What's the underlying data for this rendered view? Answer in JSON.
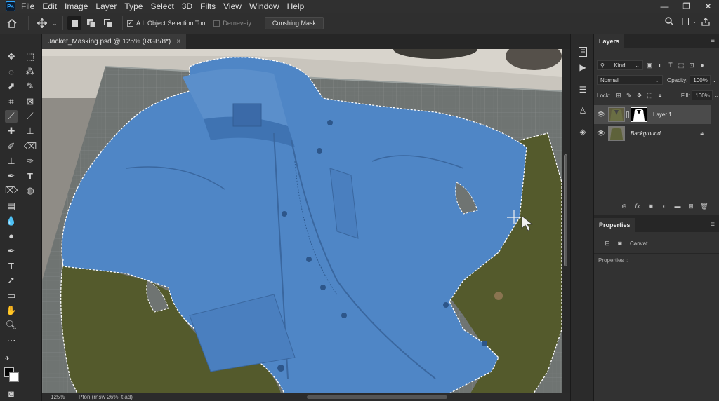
{
  "app": {
    "logo": "Ps"
  },
  "menu": [
    "File",
    "Edit",
    "Image",
    "Layer",
    "Type",
    "Select",
    "3D",
    "Filts",
    "View",
    "Window",
    "Help"
  ],
  "window_controls": {
    "minimize": "—",
    "restore": "❐",
    "close": "✕"
  },
  "options_bar": {
    "ai_tool_label": "A.I. Object Selection Tool",
    "ai_tool_checked": true,
    "second_option_label": "Derneveiy",
    "second_option_checked": false,
    "mask_button_label": "Cunshing Mask"
  },
  "document": {
    "tab_title": "Jacket_Masking.psd @ 125% (RGB/8*)",
    "close_glyph": "×"
  },
  "status_bar": {
    "zoom": "125%",
    "info": "Pfon (rnsw 26%, t:ad)"
  },
  "layers_panel": {
    "tab_label": "Layers",
    "kind_label": "Kind",
    "blend_mode": "Normal",
    "opacity_label": "Opacity:",
    "opacity_value": "100%",
    "lock_label": "Lock:",
    "fill_label": "Fill:",
    "fill_value": "100%",
    "layers": [
      {
        "name": "Layer 1",
        "selected": true,
        "has_mask": true,
        "locked": false
      },
      {
        "name": "Background",
        "selected": false,
        "has_mask": false,
        "locked": true
      }
    ]
  },
  "properties_panel": {
    "tab_label": "Properties",
    "type_label": "Canvat",
    "body_label": "Properties ::"
  },
  "colors": {
    "selection_overlay": "#4f86c6",
    "jacket_olive": "#555a2e",
    "ui_dark": "#2b2b2b",
    "foreground": "#050505",
    "background": "#ffffff"
  }
}
